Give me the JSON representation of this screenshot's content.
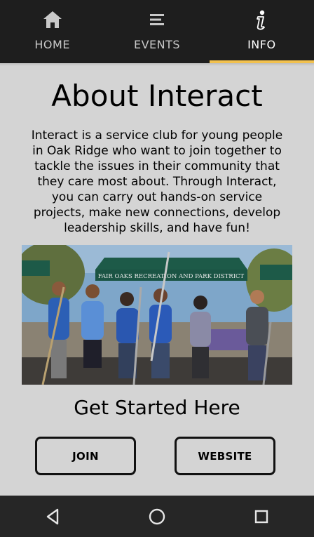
{
  "tabs": [
    {
      "label": "HOME",
      "icon": "home-icon",
      "active": false
    },
    {
      "label": "EVENTS",
      "icon": "list-icon",
      "active": false
    },
    {
      "label": "INFO",
      "icon": "info-icon",
      "active": true
    }
  ],
  "accent_color": "#f2c14e",
  "content": {
    "title": "About Interact",
    "description": "Interact is a service club for young people in Oak Ridge who want to join together to tackle the issues in their community that they care most about. Through Interact, you can carry out hands-on service projects, make new connections, develop leadership skills, and have fun!",
    "photo_sign": "FAIR OAKS RECREATION AND PARK DISTRICT",
    "get_started": "Get Started Here",
    "join_label": "JOIN",
    "website_label": "WEBSITE"
  },
  "navbar": {
    "back": "back-icon",
    "home": "home-circle-icon",
    "recents": "recents-icon"
  }
}
